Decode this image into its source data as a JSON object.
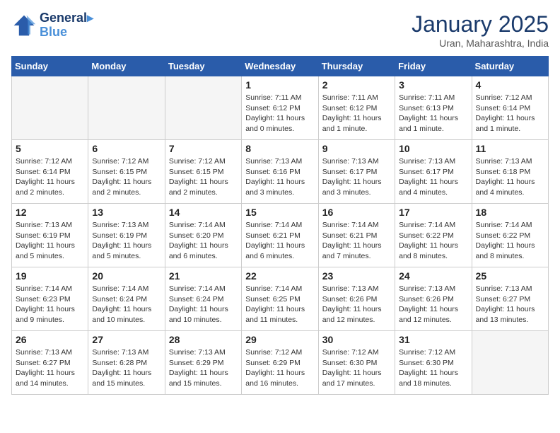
{
  "header": {
    "logo_line1": "General",
    "logo_line2": "Blue",
    "month_title": "January 2025",
    "subtitle": "Uran, Maharashtra, India"
  },
  "days_of_week": [
    "Sunday",
    "Monday",
    "Tuesday",
    "Wednesday",
    "Thursday",
    "Friday",
    "Saturday"
  ],
  "weeks": [
    [
      {
        "day": "",
        "info": ""
      },
      {
        "day": "",
        "info": ""
      },
      {
        "day": "",
        "info": ""
      },
      {
        "day": "1",
        "info": "Sunrise: 7:11 AM\nSunset: 6:12 PM\nDaylight: 11 hours\nand 0 minutes."
      },
      {
        "day": "2",
        "info": "Sunrise: 7:11 AM\nSunset: 6:12 PM\nDaylight: 11 hours\nand 1 minute."
      },
      {
        "day": "3",
        "info": "Sunrise: 7:11 AM\nSunset: 6:13 PM\nDaylight: 11 hours\nand 1 minute."
      },
      {
        "day": "4",
        "info": "Sunrise: 7:12 AM\nSunset: 6:14 PM\nDaylight: 11 hours\nand 1 minute."
      }
    ],
    [
      {
        "day": "5",
        "info": "Sunrise: 7:12 AM\nSunset: 6:14 PM\nDaylight: 11 hours\nand 2 minutes."
      },
      {
        "day": "6",
        "info": "Sunrise: 7:12 AM\nSunset: 6:15 PM\nDaylight: 11 hours\nand 2 minutes."
      },
      {
        "day": "7",
        "info": "Sunrise: 7:12 AM\nSunset: 6:15 PM\nDaylight: 11 hours\nand 2 minutes."
      },
      {
        "day": "8",
        "info": "Sunrise: 7:13 AM\nSunset: 6:16 PM\nDaylight: 11 hours\nand 3 minutes."
      },
      {
        "day": "9",
        "info": "Sunrise: 7:13 AM\nSunset: 6:17 PM\nDaylight: 11 hours\nand 3 minutes."
      },
      {
        "day": "10",
        "info": "Sunrise: 7:13 AM\nSunset: 6:17 PM\nDaylight: 11 hours\nand 4 minutes."
      },
      {
        "day": "11",
        "info": "Sunrise: 7:13 AM\nSunset: 6:18 PM\nDaylight: 11 hours\nand 4 minutes."
      }
    ],
    [
      {
        "day": "12",
        "info": "Sunrise: 7:13 AM\nSunset: 6:19 PM\nDaylight: 11 hours\nand 5 minutes."
      },
      {
        "day": "13",
        "info": "Sunrise: 7:13 AM\nSunset: 6:19 PM\nDaylight: 11 hours\nand 5 minutes."
      },
      {
        "day": "14",
        "info": "Sunrise: 7:14 AM\nSunset: 6:20 PM\nDaylight: 11 hours\nand 6 minutes."
      },
      {
        "day": "15",
        "info": "Sunrise: 7:14 AM\nSunset: 6:21 PM\nDaylight: 11 hours\nand 6 minutes."
      },
      {
        "day": "16",
        "info": "Sunrise: 7:14 AM\nSunset: 6:21 PM\nDaylight: 11 hours\nand 7 minutes."
      },
      {
        "day": "17",
        "info": "Sunrise: 7:14 AM\nSunset: 6:22 PM\nDaylight: 11 hours\nand 8 minutes."
      },
      {
        "day": "18",
        "info": "Sunrise: 7:14 AM\nSunset: 6:22 PM\nDaylight: 11 hours\nand 8 minutes."
      }
    ],
    [
      {
        "day": "19",
        "info": "Sunrise: 7:14 AM\nSunset: 6:23 PM\nDaylight: 11 hours\nand 9 minutes."
      },
      {
        "day": "20",
        "info": "Sunrise: 7:14 AM\nSunset: 6:24 PM\nDaylight: 11 hours\nand 10 minutes."
      },
      {
        "day": "21",
        "info": "Sunrise: 7:14 AM\nSunset: 6:24 PM\nDaylight: 11 hours\nand 10 minutes."
      },
      {
        "day": "22",
        "info": "Sunrise: 7:14 AM\nSunset: 6:25 PM\nDaylight: 11 hours\nand 11 minutes."
      },
      {
        "day": "23",
        "info": "Sunrise: 7:13 AM\nSunset: 6:26 PM\nDaylight: 11 hours\nand 12 minutes."
      },
      {
        "day": "24",
        "info": "Sunrise: 7:13 AM\nSunset: 6:26 PM\nDaylight: 11 hours\nand 12 minutes."
      },
      {
        "day": "25",
        "info": "Sunrise: 7:13 AM\nSunset: 6:27 PM\nDaylight: 11 hours\nand 13 minutes."
      }
    ],
    [
      {
        "day": "26",
        "info": "Sunrise: 7:13 AM\nSunset: 6:27 PM\nDaylight: 11 hours\nand 14 minutes."
      },
      {
        "day": "27",
        "info": "Sunrise: 7:13 AM\nSunset: 6:28 PM\nDaylight: 11 hours\nand 15 minutes."
      },
      {
        "day": "28",
        "info": "Sunrise: 7:13 AM\nSunset: 6:29 PM\nDaylight: 11 hours\nand 15 minutes."
      },
      {
        "day": "29",
        "info": "Sunrise: 7:12 AM\nSunset: 6:29 PM\nDaylight: 11 hours\nand 16 minutes."
      },
      {
        "day": "30",
        "info": "Sunrise: 7:12 AM\nSunset: 6:30 PM\nDaylight: 11 hours\nand 17 minutes."
      },
      {
        "day": "31",
        "info": "Sunrise: 7:12 AM\nSunset: 6:30 PM\nDaylight: 11 hours\nand 18 minutes."
      },
      {
        "day": "",
        "info": ""
      }
    ]
  ]
}
